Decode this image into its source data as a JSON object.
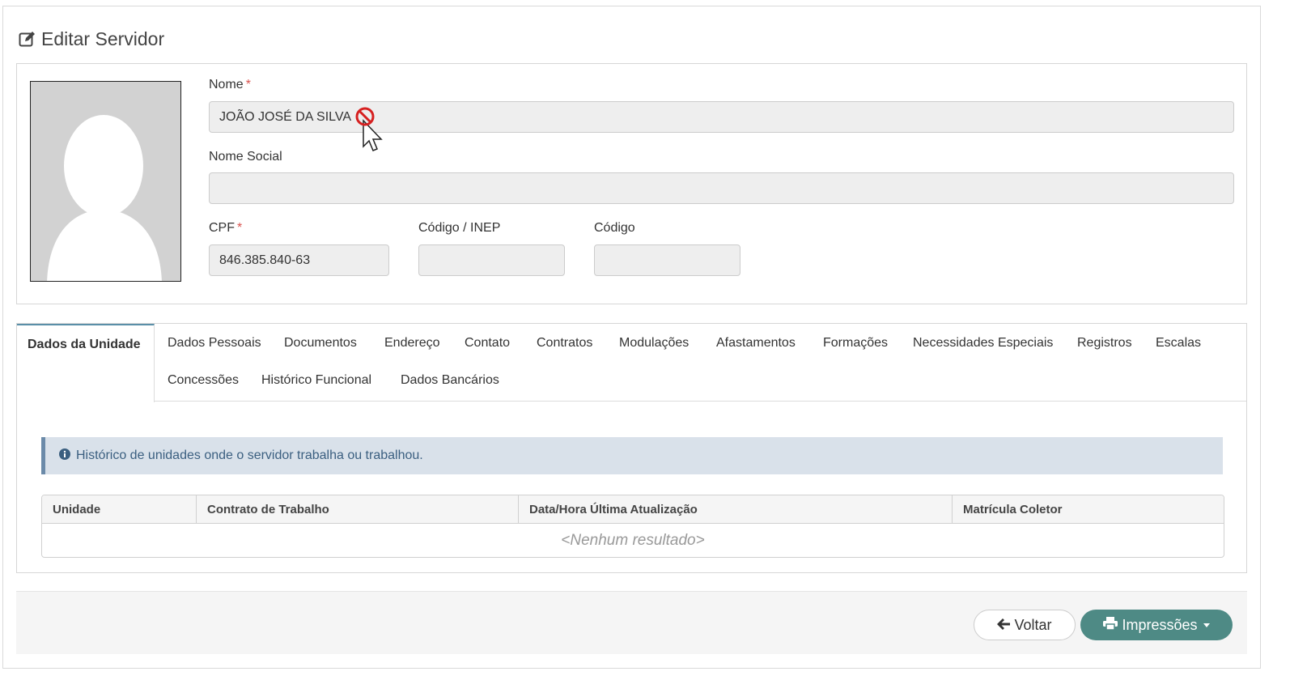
{
  "page": {
    "title": "Editar Servidor",
    "icon": "edit-icon"
  },
  "profile": {
    "photo_icon": "user-silhouette-icon",
    "nome": {
      "label": "Nome",
      "required_mark": "*",
      "value": "JOÃO JOSÉ DA SILVA"
    },
    "nome_social": {
      "label": "Nome Social",
      "value": ""
    },
    "cpf": {
      "label": "CPF",
      "required_mark": "*",
      "value": "846.385.840-63"
    },
    "codigo_inep": {
      "label": "Código / INEP",
      "value": ""
    },
    "codigo": {
      "label": "Código",
      "value": ""
    }
  },
  "tabs": {
    "active": "Dados da Unidade",
    "row1": [
      "Dados Pessoais",
      "Documentos",
      "Endereço",
      "Contato",
      "Contratos",
      "Modulações",
      "Afastamentos",
      "Formações",
      "Necessidades Especiais",
      "Registros",
      "Escalas"
    ],
    "row2": [
      "Concessões",
      "Histórico Funcional",
      "Dados Bancários"
    ]
  },
  "info": {
    "icon": "info-circle-icon",
    "text": "Histórico de unidades onde o servidor trabalha ou trabalhou."
  },
  "grid": {
    "columns": [
      "Unidade",
      "Contrato de Trabalho",
      "Data/Hora Última Atualização",
      "Matrícula Coletor"
    ],
    "empty_text": "<Nenhum resultado>"
  },
  "footer": {
    "back_label": "Voltar",
    "back_icon": "arrow-left-icon",
    "print_label": "Impressões",
    "print_icon": "printer-icon"
  },
  "colors": {
    "accent": "#4e8a85",
    "info_bg": "#d9e1ea",
    "info_text": "#3b5f80",
    "required": "#d9534f"
  }
}
